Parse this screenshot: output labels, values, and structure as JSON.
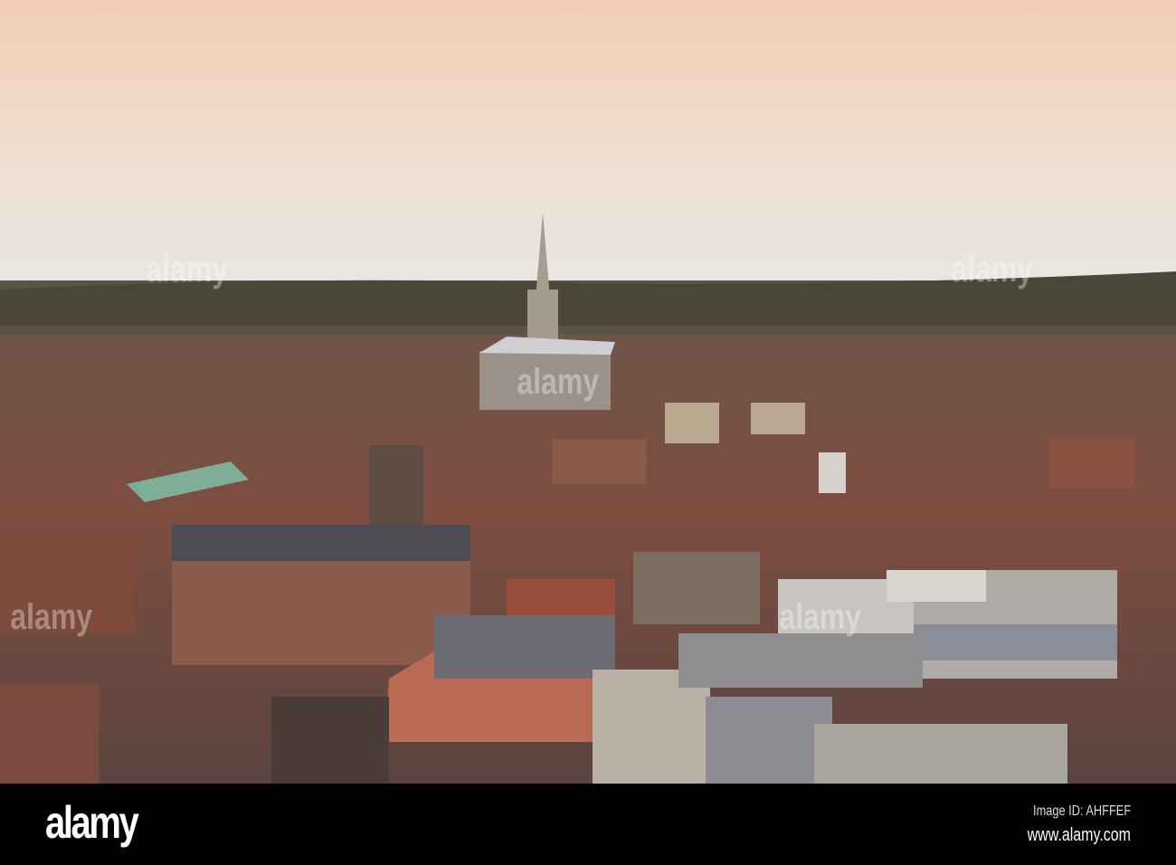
{
  "photo": {
    "subject": "aerial-city-view",
    "colors": {
      "sky_top": "#f2cdb4",
      "sky_horizon": "#ebe6e0",
      "trees": "#4a4638",
      "roofs": "#8a4a3a"
    }
  },
  "footer": {
    "logo": "alamy",
    "image_id": "Image ID: AHFFEF",
    "url": "www.alamy.com"
  }
}
